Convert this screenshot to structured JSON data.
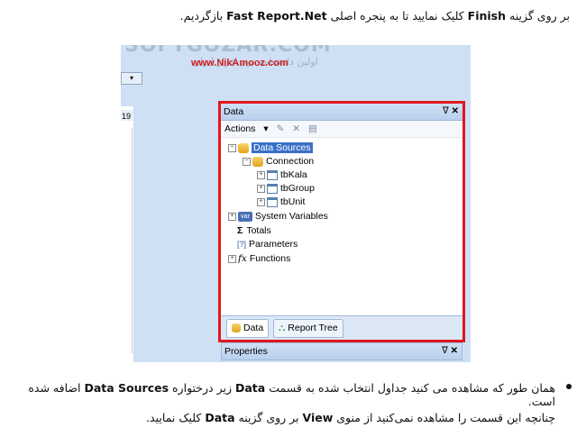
{
  "doc": {
    "intro": {
      "pre": "بر روی گزینه ",
      "k1": "Finish",
      "mid": " کلیک نمایید تا به پنجره اصلی ",
      "k2": "Fast Report.Net",
      "post": " بازگردیم."
    },
    "bullet1": {
      "pre": "همان طور که مشاهده می کنید جداول انتخاب شده به قسمت ",
      "k1": "Data",
      "mid": " زیر درختواره ",
      "k2": "Data Sources",
      "post": " اضافه شده است."
    },
    "bullet2": {
      "pre": "چنانچه این قسمت را مشاهده نمی‌کنید از منوی ",
      "k1": "View",
      "mid": " بر روی گزینه ",
      "k2": "Data",
      "post": " کلیک نمایید."
    }
  },
  "watermark": {
    "brand": "SOFTGOZAR.COM",
    "tag": "اولین دانشنامه نرم افزار ایران",
    "site": "www.NikAmooz.com"
  },
  "screenshot": {
    "ruler_num": "19",
    "panel_title": "Data",
    "actions_label": "Actions",
    "tree": [
      {
        "label": "Data Sources",
        "selected": true
      },
      {
        "label": "Connection"
      },
      {
        "label": "tbKala"
      },
      {
        "label": "tbGroup"
      },
      {
        "label": "tbUnit"
      },
      {
        "label": "System Variables",
        "icon": "var"
      },
      {
        "label": "Totals"
      },
      {
        "label": "Parameters"
      },
      {
        "label": "Functions"
      }
    ],
    "tabs": {
      "data": "Data",
      "report_tree": "Report Tree"
    },
    "properties_title": "Properties",
    "pin": "ᐁ",
    "close": "✕",
    "var_text": "var"
  }
}
